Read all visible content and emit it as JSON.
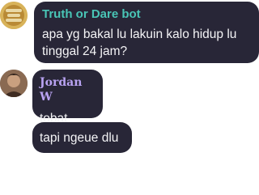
{
  "messages": [
    {
      "author": "Truth or Dare bot",
      "text": "apa yg bakal lu lakuin kalo hidup lu\ntinggal 24 jam?",
      "author_color": "#49c5b6",
      "avatar": "bot-avatar"
    },
    {
      "author": "Jordan W",
      "text": "tobat",
      "author_color": "#b9a3f2",
      "avatar": "user-avatar"
    },
    {
      "author": "",
      "text": "tapi ngeue dlu"
    }
  ],
  "colors": {
    "bubble": "#282637",
    "text": "#f4f4f6",
    "background": "#ffffff"
  }
}
